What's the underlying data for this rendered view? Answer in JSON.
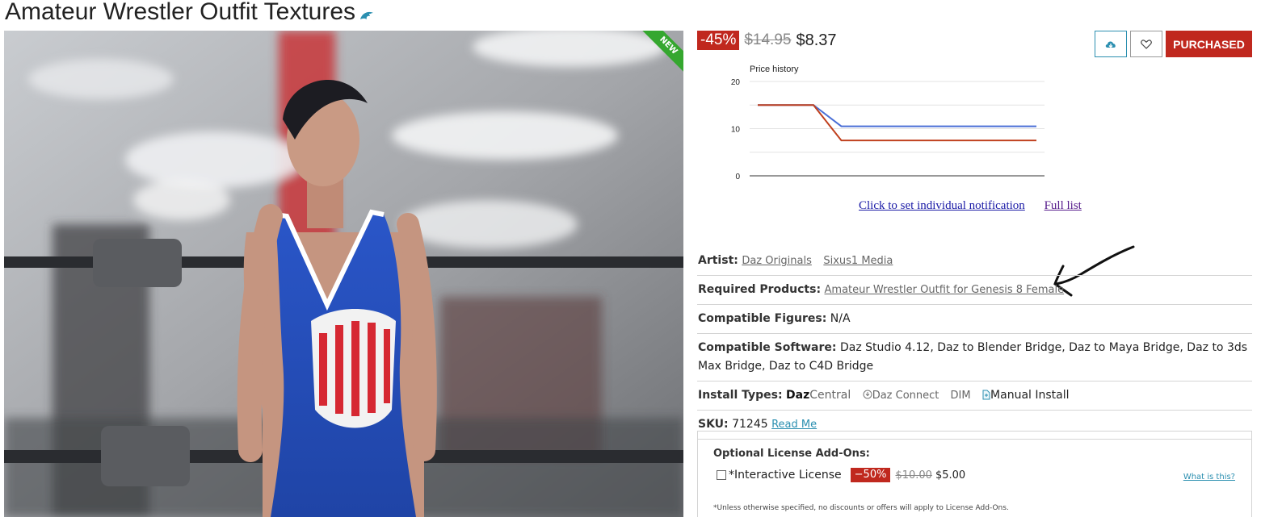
{
  "title": "Amateur Wrestler Outfit Textures",
  "image": {
    "ribbon": "NEW"
  },
  "price": {
    "discount": "-45%",
    "old": "$14.95",
    "new": "$8.37"
  },
  "actions": {
    "download_icon": "cloud-download-icon",
    "wishlist_icon": "heart-icon",
    "purchased_label": "PURCHASED"
  },
  "chart_data": {
    "type": "line",
    "title": "Price history",
    "ylim": [
      0,
      20
    ],
    "yticks": [
      "20",
      "10",
      "0"
    ],
    "x": [
      0,
      1,
      2,
      3,
      4,
      5,
      6,
      7,
      8,
      9,
      10
    ],
    "series": [
      {
        "color": "#4a6fd6",
        "values": [
          15,
          15,
          15,
          10.5,
          10.5,
          10.5,
          10.5,
          10.5,
          10.5,
          10.5,
          10.5
        ]
      },
      {
        "color": "#c0401e",
        "values": [
          15,
          15,
          15,
          7.5,
          7.5,
          7.5,
          7.5,
          7.5,
          7.5,
          7.5,
          7.5
        ]
      }
    ],
    "grid": true
  },
  "notify": {
    "set_notification": "Click to set individual notification",
    "full_list": "Full list"
  },
  "details": {
    "artist_label": "Artist:",
    "artists": [
      "Daz Originals",
      "Sixus1 Media"
    ],
    "required_label": "Required Products:",
    "required_product": "Amateur Wrestler Outfit for Genesis 8 Female",
    "figures_label": "Compatible Figures:",
    "figures_value": "N/A",
    "software_label": "Compatible Software:",
    "software_value": "Daz Studio 4.12, Daz to Blender Bridge, Daz to Maya Bridge, Daz to 3ds Max Bridge, Daz to C4D Bridge",
    "install_label": "Install Types:",
    "install_daz": "Daz",
    "install_central": "Central",
    "install_connect": "Daz Connect",
    "install_dim": "DIM",
    "install_manual": "Manual Install",
    "sku_label": "SKU:",
    "sku_value": "71245",
    "read_me": "Read Me"
  },
  "license": {
    "title": "Optional License Add-Ons:",
    "item": "*Interactive License",
    "discount": "−50%",
    "old": "$10.00",
    "new": "$5.00",
    "what": "What is this?",
    "note": "*Unless otherwise specified, no discounts or offers will apply to License Add-Ons."
  }
}
